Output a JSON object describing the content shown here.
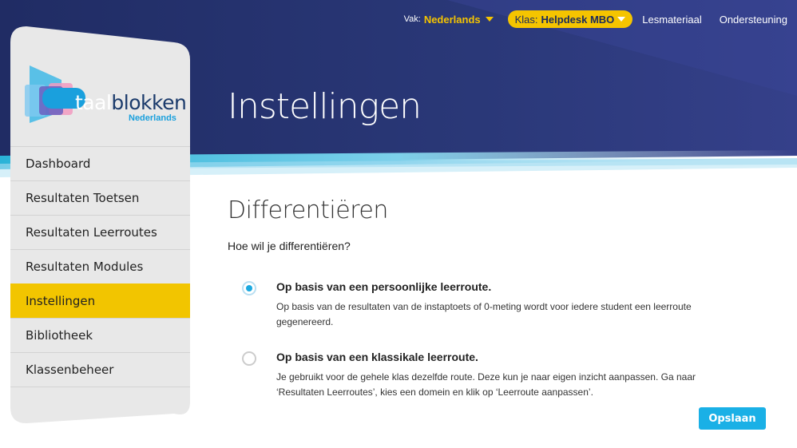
{
  "topnav": {
    "vak_label": "Vak:",
    "vak_value": "Nederlands",
    "klas_label": "Klas:",
    "klas_value": "Helpdesk MBO",
    "lesmateriaal": "Lesmateriaal",
    "ondersteuning": "Ondersteuning"
  },
  "logo": {
    "taal": "taal",
    "blokken": "blokken",
    "subtitle": "Nederlands"
  },
  "sidebar": {
    "items": [
      {
        "label": "Dashboard"
      },
      {
        "label": "Resultaten Toetsen"
      },
      {
        "label": "Resultaten Leerroutes"
      },
      {
        "label": "Resultaten Modules"
      },
      {
        "label": "Instellingen",
        "active": true
      },
      {
        "label": "Bibliotheek"
      },
      {
        "label": "Klassenbeheer"
      }
    ]
  },
  "page": {
    "title": "Instellingen",
    "section_title": "Differentiëren",
    "question": "Hoe wil je differentiëren?"
  },
  "options": [
    {
      "title": "Op basis van een persoonlijke leerroute.",
      "description": "Op basis van de resultaten van de instaptoets of 0-meting wordt voor iedere student een leerroute gegenereerd.",
      "selected": true
    },
    {
      "title": "Op basis van een klassikale leerroute.",
      "description": "Je gebruikt voor de gehele klas dezelfde route. Deze kun je naar eigen inzicht aanpassen. Ga naar ‘Resultaten Leerroutes’, kies een domein en klik op ‘Leerroute aanpassen’.",
      "selected": false
    }
  ],
  "save_label": "Opslaan",
  "colors": {
    "navy": "#2a3a7c",
    "accent_yellow": "#f2c500",
    "accent_blue": "#1ab0e6",
    "sidebar_gray": "#e8e8e8"
  },
  "icons": {
    "dropdown": "chevron-down-icon",
    "radio_selected": "radio-checked-icon",
    "radio_empty": "radio-empty-icon"
  }
}
